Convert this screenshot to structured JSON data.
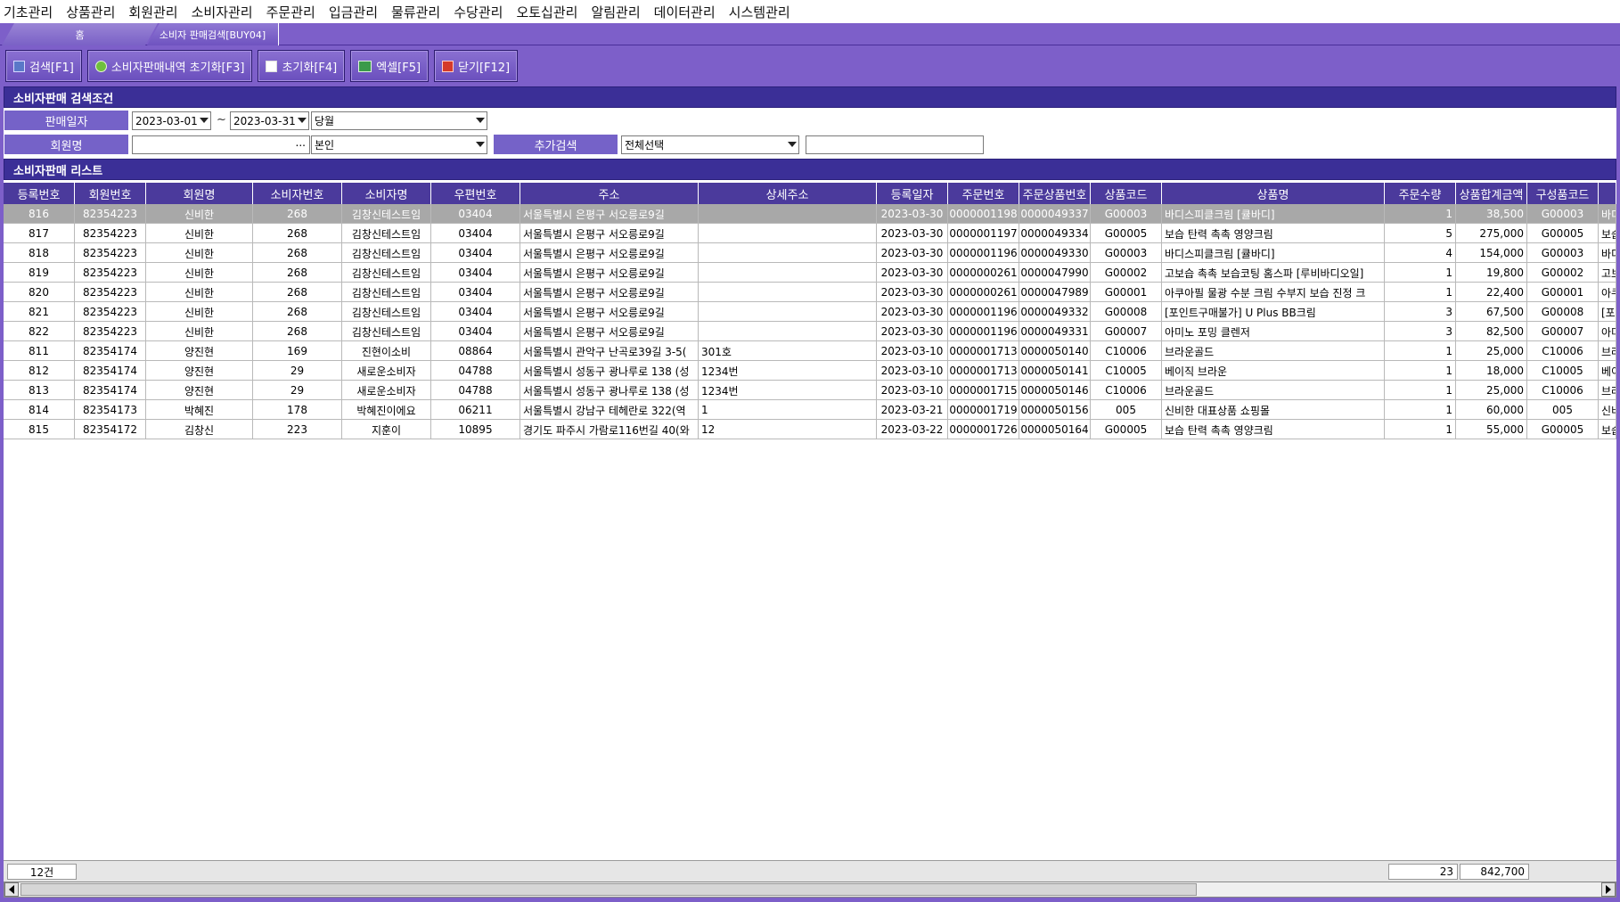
{
  "menu": [
    "기초관리",
    "상품관리",
    "회원관리",
    "소비자관리",
    "주문관리",
    "입금관리",
    "물류관리",
    "수당관리",
    "오토십관리",
    "알림관리",
    "데이터관리",
    "시스템관리"
  ],
  "tabs": {
    "home": "홈",
    "active": "소비자 판매검색[BUY04]"
  },
  "toolbar": {
    "search": "검색[F1]",
    "reset_sales": "소비자판매내역 초기화[F3]",
    "reset": "초기화[F4]",
    "excel": "엑셀[F5]",
    "close": "닫기[F12]"
  },
  "search_section": {
    "title": "소비자판매 검색조건",
    "sale_date_label": "판매일자",
    "date_from": "2023-03-01",
    "tilde": "~",
    "date_to": "2023-03-31",
    "period": "당월",
    "member_label": "회원명",
    "member_value": "",
    "member_btn": "...",
    "relation": "본인",
    "extra_label": "추가검색",
    "extra_select": "전체선택",
    "extra_value": ""
  },
  "list_section": {
    "title": "소비자판매 리스트"
  },
  "columns": [
    "등록번호",
    "회원번호",
    "회원명",
    "소비자번호",
    "소비자명",
    "우편번호",
    "주소",
    "상세주소",
    "등록일자",
    "주문번호",
    "주문상품번호",
    "상품코드",
    "상품명",
    "주문수량",
    "상품합계금액",
    "구성품코드",
    ""
  ],
  "rows": [
    [
      "816",
      "82354223",
      "신비한",
      "268",
      "김창신테스트임",
      "03404",
      "서울특별시 은평구 서오릉로9길",
      "",
      "2023-03-30",
      "0000001198",
      "0000049337",
      "G00003",
      "바디스피클크림 [큘바디]",
      "1",
      "38,500",
      "G00003",
      "바디"
    ],
    [
      "817",
      "82354223",
      "신비한",
      "268",
      "김창신테스트임",
      "03404",
      "서울특별시 은평구 서오릉로9길",
      "",
      "2023-03-30",
      "0000001197",
      "0000049334",
      "G00005",
      "보습 탄력 촉촉 영양크림",
      "5",
      "275,000",
      "G00005",
      "보습"
    ],
    [
      "818",
      "82354223",
      "신비한",
      "268",
      "김창신테스트임",
      "03404",
      "서울특별시 은평구 서오릉로9길",
      "",
      "2023-03-30",
      "0000001196",
      "0000049330",
      "G00003",
      "바디스피클크림 [큘바디]",
      "4",
      "154,000",
      "G00003",
      "바디"
    ],
    [
      "819",
      "82354223",
      "신비한",
      "268",
      "김창신테스트임",
      "03404",
      "서울특별시 은평구 서오릉로9길",
      "",
      "2023-03-30",
      "0000000261",
      "0000047990",
      "G00002",
      "고보습 촉촉 보습코팅 홈스파 [루비바디오일]",
      "1",
      "19,800",
      "G00002",
      "고보"
    ],
    [
      "820",
      "82354223",
      "신비한",
      "268",
      "김창신테스트임",
      "03404",
      "서울특별시 은평구 서오릉로9길",
      "",
      "2023-03-30",
      "0000000261",
      "0000047989",
      "G00001",
      "아쿠아필 물광 수분 크림 수부지 보습 진정 크",
      "1",
      "22,400",
      "G00001",
      "아쿠"
    ],
    [
      "821",
      "82354223",
      "신비한",
      "268",
      "김창신테스트임",
      "03404",
      "서울특별시 은평구 서오릉로9길",
      "",
      "2023-03-30",
      "0000001196",
      "0000049332",
      "G00008",
      "[포인트구매불가] U Plus BB크림",
      "3",
      "67,500",
      "G00008",
      "[포"
    ],
    [
      "822",
      "82354223",
      "신비한",
      "268",
      "김창신테스트임",
      "03404",
      "서울특별시 은평구 서오릉로9길",
      "",
      "2023-03-30",
      "0000001196",
      "0000049331",
      "G00007",
      "아미노 포밍 클렌저",
      "3",
      "82,500",
      "G00007",
      "아미"
    ],
    [
      "811",
      "82354174",
      "양진현",
      "169",
      "진현이소비",
      "08864",
      "서울특별시 관악구 난곡로39길 3-5(",
      "301호",
      "2023-03-10",
      "0000001713",
      "0000050140",
      "C10006",
      "브라운골드",
      "1",
      "25,000",
      "C10006",
      "브라"
    ],
    [
      "812",
      "82354174",
      "양진현",
      "29",
      "새로운소비자",
      "04788",
      "서울특별시 성동구 광나루로 138 (성",
      "1234번",
      "2023-03-10",
      "0000001713",
      "0000050141",
      "C10005",
      "베이직 브라운",
      "1",
      "18,000",
      "C10005",
      "베이"
    ],
    [
      "813",
      "82354174",
      "양진현",
      "29",
      "새로운소비자",
      "04788",
      "서울특별시 성동구 광나루로 138 (성",
      "1234번",
      "2023-03-10",
      "0000001715",
      "0000050146",
      "C10006",
      "브라운골드",
      "1",
      "25,000",
      "C10006",
      "브라"
    ],
    [
      "814",
      "82354173",
      "박혜진",
      "178",
      "박혜진이에요",
      "06211",
      "서울특별시 강남구 테헤란로 322(역",
      "1",
      "2023-03-21",
      "0000001719",
      "0000050156",
      "005",
      "신비한 대표상품 쇼핑몰",
      "1",
      "60,000",
      "005",
      "신비"
    ],
    [
      "815",
      "82354172",
      "김창신",
      "223",
      "지훈이",
      "10895",
      "경기도 파주시 가람로116번길 40(와",
      "12",
      "2023-03-22",
      "0000001726",
      "0000050164",
      "G00005",
      "보습 탄력 촉촉 영양크림",
      "1",
      "55,000",
      "G00005",
      "보습"
    ]
  ],
  "footer": {
    "count": "12건",
    "qty_total": "23",
    "amount_total": "842,700"
  },
  "colors": {
    "accent": "#7d5fc9",
    "header": "#3b2f97",
    "selected_row": "#a8a8a8"
  }
}
